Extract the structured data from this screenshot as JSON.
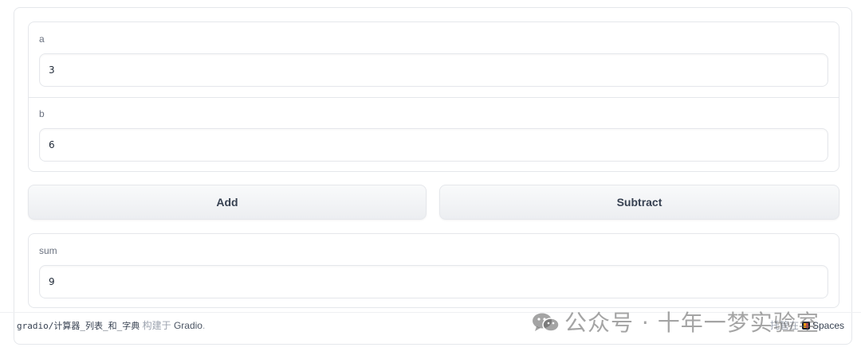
{
  "inputs": {
    "a": {
      "label": "a",
      "value": "3"
    },
    "b": {
      "label": "b",
      "value": "6"
    }
  },
  "buttons": {
    "add": "Add",
    "subtract": "Subtract"
  },
  "output": {
    "label": "sum",
    "value": "9"
  },
  "footer": {
    "space_name": "gradio/计算器_列表_和_字典",
    "built_with": "构建于",
    "gradio_link": "Gradio",
    "period": ".",
    "hosted_on": "托管在",
    "spaces_link": "Spaces"
  },
  "watermark": {
    "text": "公众号 · 十年一梦实验室",
    "icon": "wechat-icon"
  }
}
